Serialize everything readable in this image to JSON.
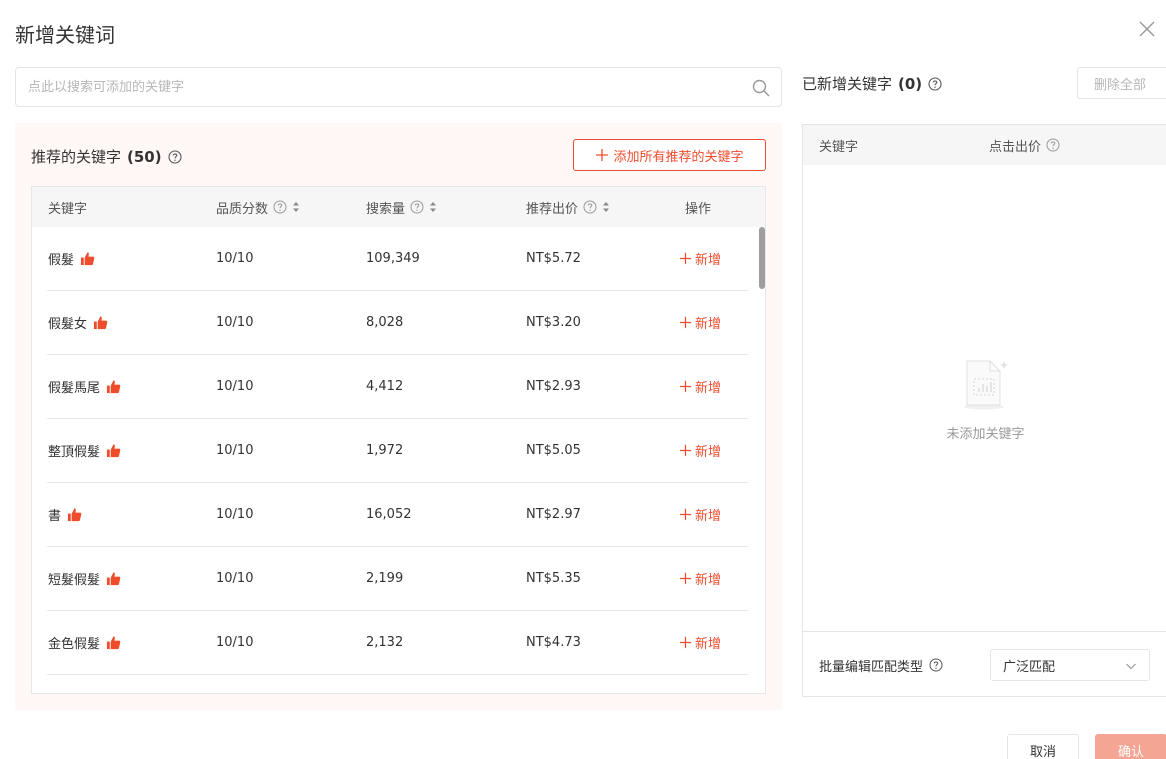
{
  "dialog": {
    "title": "新增关键词"
  },
  "search": {
    "placeholder": "点此以搜索可添加的关键字"
  },
  "recommended": {
    "title": "推荐的关键字",
    "count": "(50)",
    "add_all_label": "添加所有推荐的关键字",
    "columns": {
      "keyword": "关键字",
      "quality": "品质分数",
      "volume": "搜索量",
      "bid": "推荐出价",
      "action": "操作"
    },
    "rows": [
      {
        "keyword": "假髮",
        "quality": "10/10",
        "volume": "109,349",
        "bid": "NT$5.72",
        "action": "新增"
      },
      {
        "keyword": "假髮女",
        "quality": "10/10",
        "volume": "8,028",
        "bid": "NT$3.20",
        "action": "新增"
      },
      {
        "keyword": "假髮馬尾",
        "quality": "10/10",
        "volume": "4,412",
        "bid": "NT$2.93",
        "action": "新增"
      },
      {
        "keyword": "整頂假髮",
        "quality": "10/10",
        "volume": "1,972",
        "bid": "NT$5.05",
        "action": "新增"
      },
      {
        "keyword": "書",
        "quality": "10/10",
        "volume": "16,052",
        "bid": "NT$2.97",
        "action": "新增"
      },
      {
        "keyword": "短髮假髮",
        "quality": "10/10",
        "volume": "2,199",
        "bid": "NT$5.35",
        "action": "新增"
      },
      {
        "keyword": "金色假髮",
        "quality": "10/10",
        "volume": "2,132",
        "bid": "NT$4.73",
        "action": "新增"
      }
    ]
  },
  "added": {
    "title": "已新增关键字",
    "count": "(0)",
    "delete_all_label": "删除全部",
    "columns": {
      "keyword": "关键字",
      "bid": "点击出价"
    },
    "empty_text": "未添加关键字",
    "batch_label": "批量编辑匹配类型",
    "match_type": "广泛匹配"
  },
  "footer": {
    "cancel_label": "取消",
    "confirm_label": "确认"
  },
  "colors": {
    "accent": "#ee4d2d",
    "panel_bg": "#fff8f6",
    "confirm_disabled": "#f5a593"
  }
}
